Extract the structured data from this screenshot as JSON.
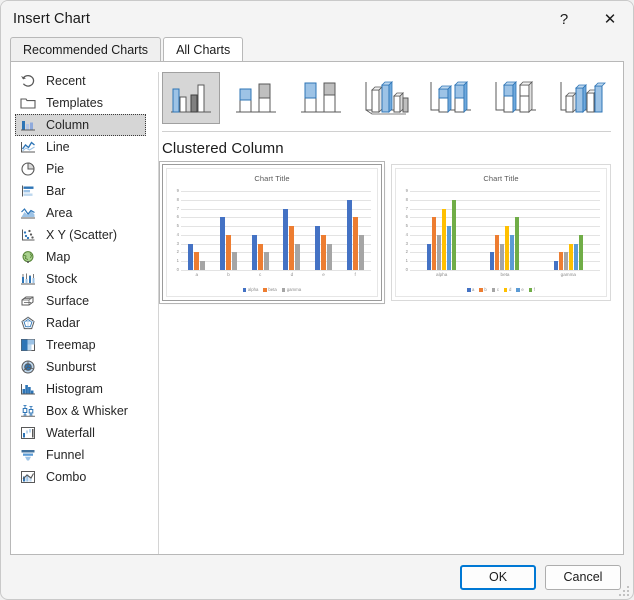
{
  "window": {
    "title": "Insert Chart",
    "help_label": "?",
    "close_label": "✕"
  },
  "tabs": [
    {
      "label": "Recommended Charts",
      "active": false
    },
    {
      "label": "All Charts",
      "active": true
    }
  ],
  "sidebar": {
    "items": [
      {
        "label": "Recent",
        "icon": "recent-icon",
        "selected": false
      },
      {
        "label": "Templates",
        "icon": "templates-folder-icon",
        "selected": false
      },
      {
        "label": "Column",
        "icon": "column-chart-icon",
        "selected": true
      },
      {
        "label": "Line",
        "icon": "line-chart-icon",
        "selected": false
      },
      {
        "label": "Pie",
        "icon": "pie-chart-icon",
        "selected": false
      },
      {
        "label": "Bar",
        "icon": "bar-chart-icon",
        "selected": false
      },
      {
        "label": "Area",
        "icon": "area-chart-icon",
        "selected": false
      },
      {
        "label": "X Y (Scatter)",
        "icon": "scatter-chart-icon",
        "selected": false
      },
      {
        "label": "Map",
        "icon": "map-chart-icon",
        "selected": false
      },
      {
        "label": "Stock",
        "icon": "stock-chart-icon",
        "selected": false
      },
      {
        "label": "Surface",
        "icon": "surface-chart-icon",
        "selected": false
      },
      {
        "label": "Radar",
        "icon": "radar-chart-icon",
        "selected": false
      },
      {
        "label": "Treemap",
        "icon": "treemap-chart-icon",
        "selected": false
      },
      {
        "label": "Sunburst",
        "icon": "sunburst-chart-icon",
        "selected": false
      },
      {
        "label": "Histogram",
        "icon": "histogram-chart-icon",
        "selected": false
      },
      {
        "label": "Box & Whisker",
        "icon": "box-whisker-chart-icon",
        "selected": false
      },
      {
        "label": "Waterfall",
        "icon": "waterfall-chart-icon",
        "selected": false
      },
      {
        "label": "Funnel",
        "icon": "funnel-chart-icon",
        "selected": false
      },
      {
        "label": "Combo",
        "icon": "combo-chart-icon",
        "selected": false
      }
    ]
  },
  "subtype_strip": [
    {
      "name": "clustered-column",
      "selected": true
    },
    {
      "name": "stacked-column",
      "selected": false
    },
    {
      "name": "100-percent-stacked-column",
      "selected": false
    },
    {
      "name": "3d-clustered-column",
      "selected": false
    },
    {
      "name": "3d-stacked-column",
      "selected": false
    },
    {
      "name": "3d-100-percent-stacked-column",
      "selected": false
    },
    {
      "name": "3d-column",
      "selected": false
    }
  ],
  "subtitle": "Clustered Column",
  "colors": {
    "series1": "#4472C4",
    "series2": "#ED7D31",
    "series3": "#A5A5A5",
    "series4": "#FFC000",
    "series5": "#5B9BD5",
    "series6": "#70AD47",
    "accent": "#0078d4"
  },
  "chart_data": [
    {
      "type": "bar",
      "title": "Chart Title",
      "xlabel": "",
      "ylabel": "",
      "ylim": [
        0,
        9
      ],
      "yticks": [
        0,
        1,
        2,
        3,
        4,
        5,
        6,
        7,
        8,
        9
      ],
      "grid": true,
      "legend_position": "bottom",
      "categories": [
        "a",
        "b",
        "c",
        "d",
        "e",
        "f"
      ],
      "series": [
        {
          "name": "alpha",
          "color": "#4472C4",
          "values": [
            3,
            6,
            4,
            7,
            5,
            8
          ]
        },
        {
          "name": "beta",
          "color": "#ED7D31",
          "values": [
            2,
            4,
            3,
            5,
            4,
            6
          ]
        },
        {
          "name": "gamma",
          "color": "#A5A5A5",
          "values": [
            1,
            2,
            2,
            3,
            3,
            4
          ]
        }
      ]
    },
    {
      "type": "bar",
      "title": "Chart Title",
      "xlabel": "",
      "ylabel": "",
      "ylim": [
        0,
        9
      ],
      "yticks": [
        0,
        1,
        2,
        3,
        4,
        5,
        6,
        7,
        8,
        9
      ],
      "grid": true,
      "legend_position": "bottom",
      "categories": [
        "alpha",
        "beta",
        "gamma"
      ],
      "series": [
        {
          "name": "a",
          "color": "#4472C4",
          "values": [
            3,
            2,
            1
          ]
        },
        {
          "name": "b",
          "color": "#ED7D31",
          "values": [
            6,
            4,
            2
          ]
        },
        {
          "name": "c",
          "color": "#A5A5A5",
          "values": [
            4,
            3,
            2
          ]
        },
        {
          "name": "d",
          "color": "#FFC000",
          "values": [
            7,
            5,
            3
          ]
        },
        {
          "name": "e",
          "color": "#5B9BD5",
          "values": [
            5,
            4,
            3
          ]
        },
        {
          "name": "f",
          "color": "#70AD47",
          "values": [
            8,
            6,
            4
          ]
        }
      ]
    }
  ],
  "footer": {
    "ok_label": "OK",
    "cancel_label": "Cancel"
  }
}
